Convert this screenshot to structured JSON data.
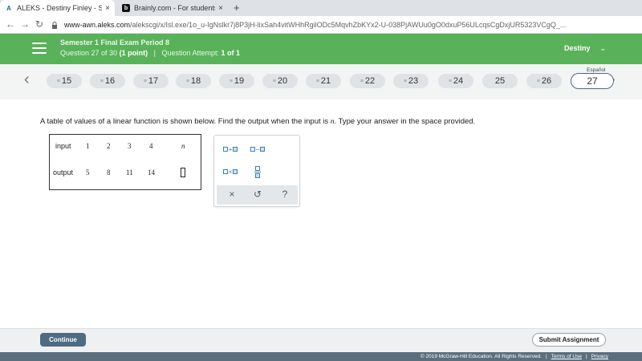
{
  "browser": {
    "tabs": [
      {
        "title": "ALEKS - Destiny Finley - Semeste",
        "close": "×"
      },
      {
        "title": "Brainly.com - For students. By st",
        "close": "×"
      }
    ],
    "new_tab": "+",
    "url_host": "www-awn.aleks.com",
    "url_path": "/alekscgi/x/Isl.exe/1o_u-IgNslkr7j8P3jH-lixSah4vitWHhRgilODc5MqvhZbKYx2-U-038PjAWUu0gO0dxuP56ULcqsCgDxjUR5323VCgQ_...",
    "nav": {
      "back": "←",
      "forward": "→",
      "reload": "↻"
    }
  },
  "header": {
    "title": "Semester 1 Final Exam Period 8",
    "question_prefix": "Question 27 of 30",
    "question_points": "(1 point)",
    "separator": "|",
    "attempt_label": "Question Attempt:",
    "attempt_value": "1 of 1",
    "user": "Destiny",
    "user_chevron": "⌄"
  },
  "qnav": {
    "prev_arrow": "‹",
    "next_arrow": "›",
    "language": "Español",
    "items": [
      {
        "num": "15",
        "answered": true
      },
      {
        "num": "16",
        "answered": true
      },
      {
        "num": "17",
        "answered": true
      },
      {
        "num": "18",
        "answered": true
      },
      {
        "num": "19",
        "answered": true
      },
      {
        "num": "20",
        "answered": true
      },
      {
        "num": "21",
        "answered": true
      },
      {
        "num": "22",
        "answered": true
      },
      {
        "num": "23",
        "answered": true
      },
      {
        "num": "24",
        "answered": true
      },
      {
        "num": "25",
        "answered": false
      },
      {
        "num": "26",
        "answered": true
      },
      {
        "num": "27",
        "answered": false,
        "current": true
      }
    ],
    "answered_marker": "≡"
  },
  "question": {
    "text_before": "A table of values of a linear function is shown below. Find the output when the input is ",
    "variable": "n",
    "text_after": ". Type your answer in the space provided."
  },
  "table": {
    "input_label": "input",
    "output_label": "output",
    "inputs": [
      "1",
      "2",
      "3",
      "4",
      "n"
    ],
    "outputs": [
      "5",
      "8",
      "11",
      "14"
    ]
  },
  "palette": {
    "plus": "+",
    "minus": "−",
    "times": "×",
    "clear": "×",
    "undo": "↺",
    "help": "?"
  },
  "footer": {
    "continue": "Continue",
    "submit": "Submit Assignment",
    "copyright": "© 2019 McGraw-Hill Education. All Rights Reserved.",
    "terms": "Terms of Use",
    "privacy": "Privacy"
  }
}
